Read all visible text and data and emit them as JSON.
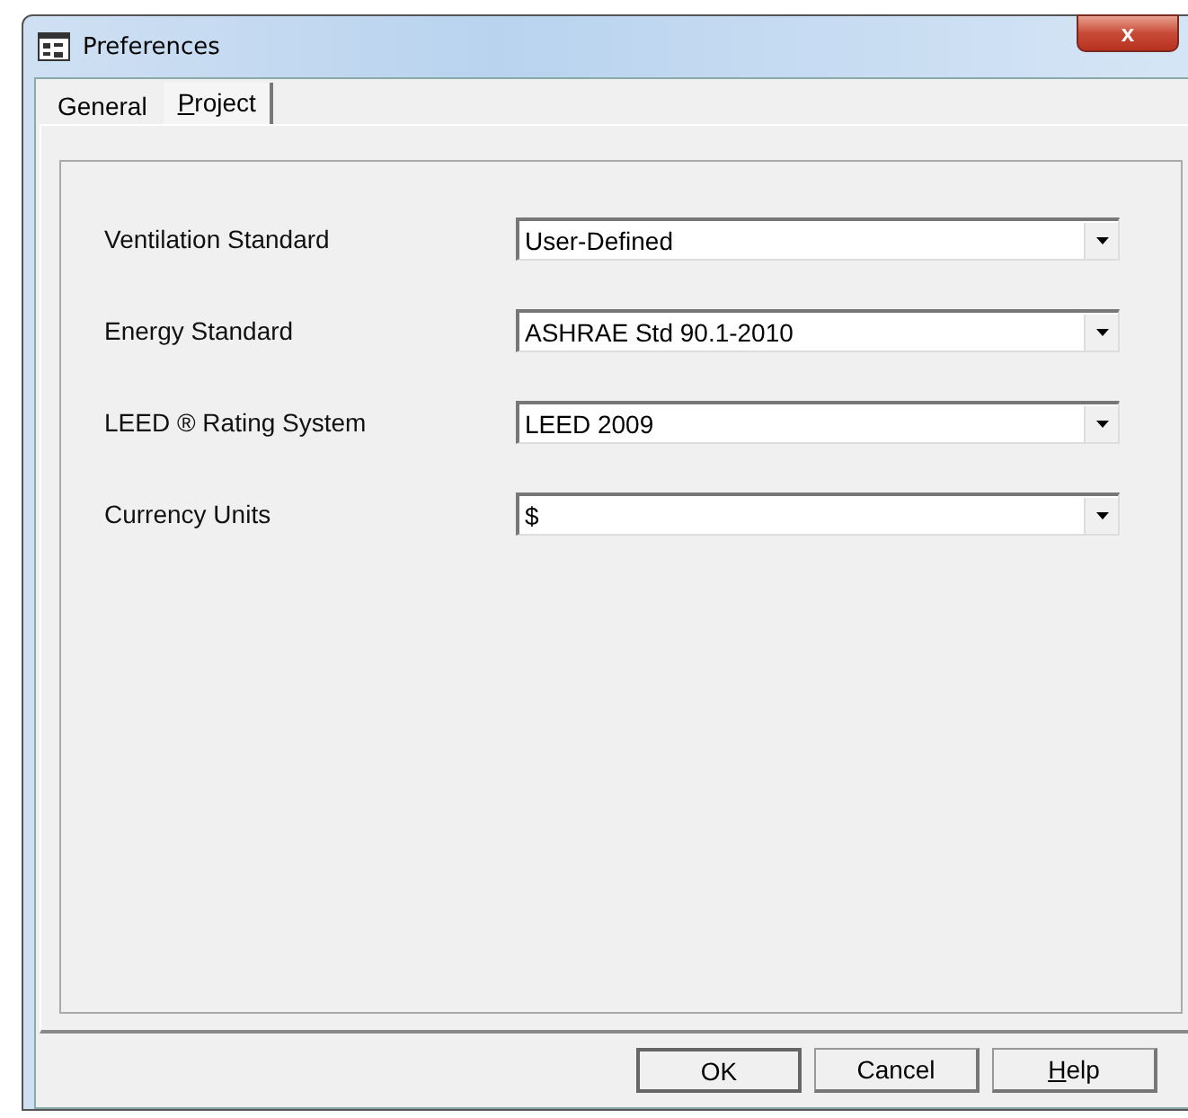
{
  "window": {
    "title": "Preferences",
    "close": "x"
  },
  "tabs": [
    {
      "label": "General",
      "selected": false,
      "underline_first": false
    },
    {
      "label": "Project",
      "selected": true,
      "underline_first": true
    }
  ],
  "fields": [
    {
      "label": "Ventilation Standard",
      "value": "User-Defined"
    },
    {
      "label": "Energy Standard",
      "value": "ASHRAE Std 90.1-2010"
    },
    {
      "label": "LEED ® Rating System",
      "value": "LEED 2009"
    },
    {
      "label": "Currency Units",
      "value": "$"
    }
  ],
  "buttons": [
    {
      "label": "OK",
      "default": true,
      "underline_first": false
    },
    {
      "label": "Cancel",
      "default": false,
      "underline_first": false
    },
    {
      "label": "Help",
      "default": false,
      "underline_first": true
    }
  ]
}
